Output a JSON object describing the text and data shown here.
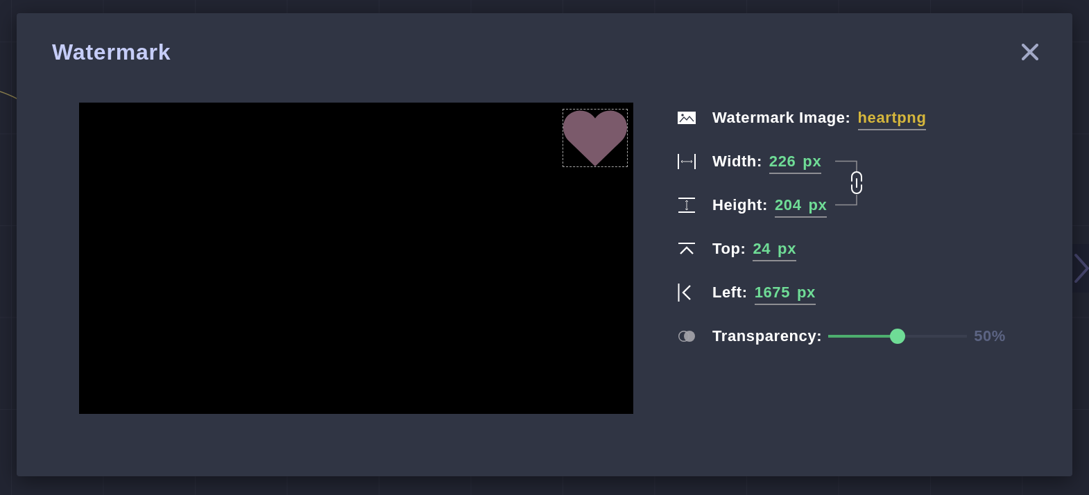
{
  "dialog": {
    "title": "Watermark"
  },
  "preview": {
    "watermark": {
      "selected": true
    }
  },
  "fields": [
    {
      "kind": "image",
      "label": "Watermark Image:",
      "value": "heartpng"
    },
    {
      "kind": "width",
      "label": "Width:",
      "value": "226",
      "unit": "px"
    },
    {
      "kind": "height",
      "label": "Height:",
      "value": "204",
      "unit": "px"
    },
    {
      "kind": "top",
      "label": "Top:",
      "value": "24",
      "unit": "px"
    },
    {
      "kind": "left",
      "label": "Left:",
      "value": "1675",
      "unit": "px"
    }
  ],
  "dimension_link": {
    "on": true
  },
  "transparency": {
    "label": "Transparency:",
    "level": 0.5,
    "reading": "50%"
  }
}
